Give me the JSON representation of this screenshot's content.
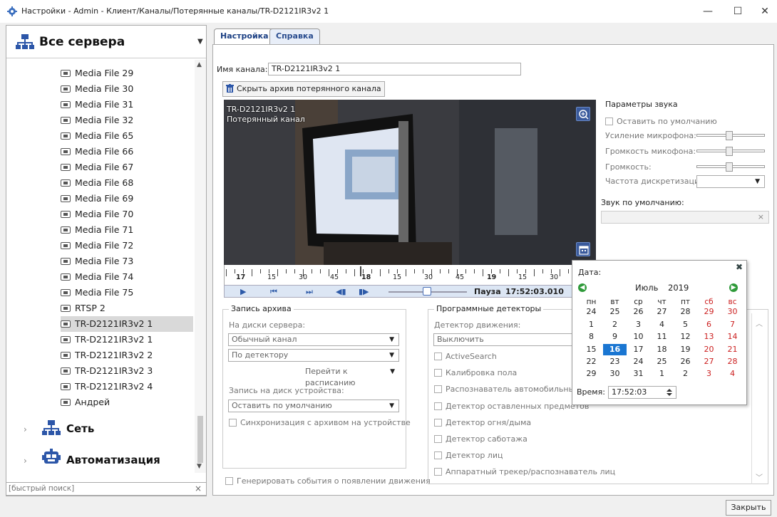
{
  "window": {
    "title": "Настройки - Admin - Клиент/Каналы/Потерянные каналы/TR-D2121IR3v2 1",
    "minimize": "—",
    "maximize": "☐",
    "close": "✕"
  },
  "sidebar": {
    "header_title": "Все сервера",
    "items": [
      {
        "label": "Media File 29"
      },
      {
        "label": "Media File 30"
      },
      {
        "label": "Media File 31"
      },
      {
        "label": "Media File 32"
      },
      {
        "label": "Media File 65"
      },
      {
        "label": "Media File 66"
      },
      {
        "label": "Media File 67"
      },
      {
        "label": "Media File 68"
      },
      {
        "label": "Media File 69"
      },
      {
        "label": "Media File 70"
      },
      {
        "label": "Media File 71"
      },
      {
        "label": "Media File 72"
      },
      {
        "label": "Media File 73"
      },
      {
        "label": "Media File 74"
      },
      {
        "label": "Media File 75"
      },
      {
        "label": "RTSP 2"
      },
      {
        "label": "TR-D2121IR3v2 1",
        "selected": true
      },
      {
        "label": "TR-D2121IR3v2 1"
      },
      {
        "label": "TR-D2121IR3v2 2"
      },
      {
        "label": "TR-D2121IR3v2 3"
      },
      {
        "label": "TR-D2121IR3v2 4"
      },
      {
        "label": "Андрей"
      }
    ],
    "groups": [
      {
        "label": "Сеть"
      },
      {
        "label": "Автоматизация"
      }
    ],
    "quick_search_placeholder": "[быстрый поиск]"
  },
  "tabs": [
    {
      "label": "Настройка",
      "active": true
    },
    {
      "label": "Справка",
      "active": false
    }
  ],
  "channel": {
    "name_label": "Имя канала:",
    "name_value": "TR-D2121IR3v2 1",
    "hide_archive_button": "Скрыть архив потерянного канала"
  },
  "video": {
    "overlay_name": "TR-D2121IR3v2 1",
    "overlay_status": "Потерянный канал",
    "timeline_labels": [
      "17",
      "15",
      "30",
      "45",
      "18",
      "15",
      "30",
      "45",
      "19",
      "15",
      "30"
    ],
    "status": "Пауза",
    "time": "17:52:03.010"
  },
  "sound": {
    "title": "Параметры звука",
    "default_checkbox": "Оставить по умолчанию",
    "mic_gain": "Усиление микрофона:",
    "mic_volume": "Громкость микофона:",
    "volume": "Громкость:",
    "sample_rate": "Частота дискретизации:",
    "default_sound_label": "Звук по умолчанию:"
  },
  "archive": {
    "title": "Запись архива",
    "server_disks_label": "На диски сервера:",
    "channel_type": "Обычный канал",
    "detector_mode": "По детектору",
    "schedule_button": "Перейти к расписанию",
    "device_disk_label": "Запись на диск устройства:",
    "device_disk_value": "Оставить по умолчанию",
    "sync_checkbox": "Синхронизация с архивом на устройстве"
  },
  "detectors": {
    "title": "Программные детекторы",
    "motion_label": "Детектор движения:",
    "motion_value": "Выключить",
    "items": [
      "ActiveSearch",
      "Калибровка пола",
      "Распознаватель автомобильных но",
      "Детектор оставленных предметов",
      "Детектор огня/дыма",
      "Детектор саботажа",
      "Детектор лиц",
      "Аппаратный трекер/распознаватель лиц"
    ]
  },
  "generate_events_checkbox": "Генерировать события о появлении движения",
  "calendar": {
    "date_label": "Дата:",
    "month": "Июль",
    "year": "2019",
    "day_headers": [
      "пн",
      "вт",
      "ср",
      "чт",
      "пт",
      "сб",
      "вс"
    ],
    "weeks": [
      [
        "24",
        "25",
        "26",
        "27",
        "28",
        "29",
        "30"
      ],
      [
        "1",
        "2",
        "3",
        "4",
        "5",
        "6",
        "7"
      ],
      [
        "8",
        "9",
        "10",
        "11",
        "12",
        "13",
        "14"
      ],
      [
        "15",
        "16",
        "17",
        "18",
        "19",
        "20",
        "21"
      ],
      [
        "22",
        "23",
        "24",
        "25",
        "26",
        "27",
        "28"
      ],
      [
        "29",
        "30",
        "31",
        "1",
        "2",
        "3",
        "4"
      ]
    ],
    "selected_day": "16",
    "time_label": "Время:",
    "time_value": "17:52:03"
  },
  "footer": {
    "close_button": "Закрыть"
  },
  "colors": {
    "accent": "#1a76d2",
    "weekend": "#cc2020",
    "tab_text": "#2a4d8f",
    "nav_green": "#2f9a3a"
  },
  "icons": {
    "servers": "servers-icon",
    "network": "network-icon",
    "automation": "robot-icon",
    "camera": "camera-icon",
    "zoom": "zoom-in-icon",
    "calendar": "calendar-icon",
    "trash": "trash-icon"
  }
}
